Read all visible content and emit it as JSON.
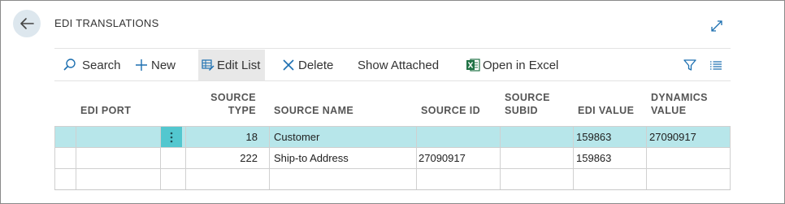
{
  "page": {
    "title": "EDI TRANSLATIONS"
  },
  "toolbar": {
    "search": "Search",
    "new": "New",
    "edit_list": "Edit List",
    "delete": "Delete",
    "show_attached": "Show Attached",
    "open_in_excel": "Open in Excel"
  },
  "grid": {
    "columns": {
      "edi_port": "EDI PORT",
      "source_type": [
        "SOURCE",
        "TYPE"
      ],
      "source_name": "SOURCE NAME",
      "source_id": "SOURCE ID",
      "source_subid": [
        "SOURCE",
        "SUBID"
      ],
      "edi_value": "EDI VALUE",
      "dynamics_value": [
        "DYNAMICS",
        "VALUE"
      ]
    },
    "rows": [
      {
        "edi_port": "",
        "source_type": "18",
        "source_name": "Customer",
        "source_id": "",
        "source_subid": "",
        "edi_value": "159863",
        "dynamics_value": "27090917",
        "selected": true
      },
      {
        "edi_port": "",
        "source_type": "222",
        "source_name": "Ship-to Address",
        "source_id": "27090917",
        "source_subid": "",
        "edi_value": "159863",
        "dynamics_value": "",
        "selected": false
      },
      {
        "edi_port": "",
        "source_type": "",
        "source_name": "",
        "source_id": "",
        "source_subid": "",
        "edi_value": "",
        "dynamics_value": "",
        "selected": false
      }
    ]
  },
  "colors": {
    "accent": "#53c7cf",
    "selected_row": "#b7e6ea",
    "excel_green": "#217346",
    "link_blue": "#1c6fb0"
  }
}
